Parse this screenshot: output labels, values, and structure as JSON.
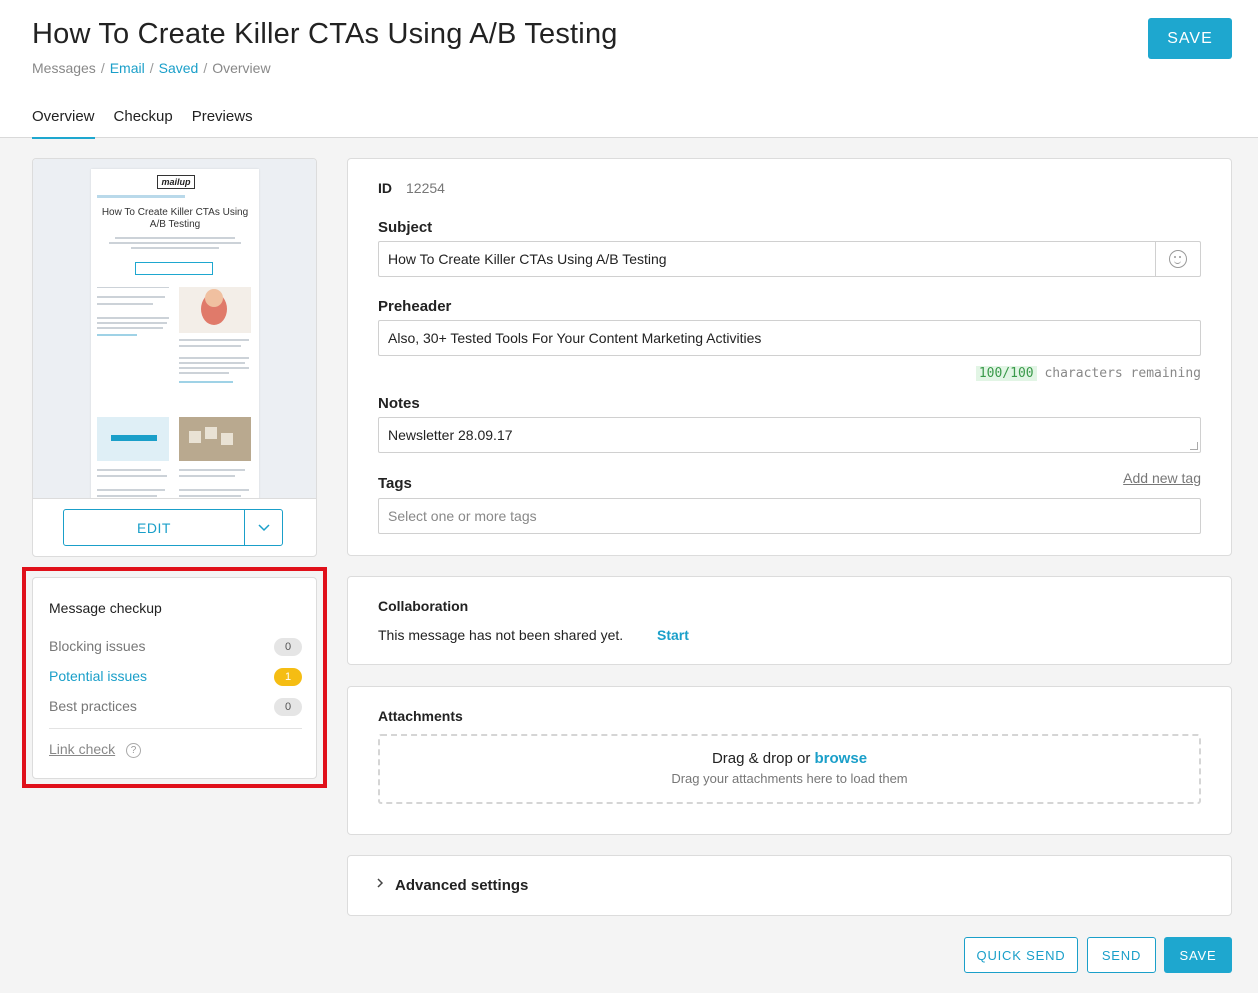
{
  "page": {
    "title": "How To Create Killer CTAs Using A/B Testing",
    "save_top": "SAVE"
  },
  "breadcrumb": {
    "messages": "Messages",
    "email": "Email",
    "saved": "Saved",
    "overview": "Overview",
    "separator": "/"
  },
  "tabs": [
    {
      "label": "Overview",
      "active": true
    },
    {
      "label": "Checkup",
      "active": false
    },
    {
      "label": "Previews",
      "active": false
    }
  ],
  "preview": {
    "heading": "How To Create Killer CTAs Using A/B Testing",
    "edit_label": "EDIT"
  },
  "checkup": {
    "title": "Message checkup",
    "items": [
      {
        "label": "Blocking issues",
        "count": "0"
      },
      {
        "label": "Potential issues",
        "count": "1"
      },
      {
        "label": "Best practices",
        "count": "0"
      }
    ],
    "link_check": "Link check",
    "help": "?"
  },
  "details": {
    "id_label": "ID",
    "id_value": "12254",
    "subject_label": "Subject",
    "subject_value": "How To Create Killer CTAs Using A/B Testing",
    "preheader_label": "Preheader",
    "preheader_value": "Also, 30+ Tested Tools For Your Content Marketing Activities",
    "chars_count": "100/100",
    "chars_text": "characters remaining",
    "notes_label": "Notes",
    "notes_value": "Newsletter 28.09.17",
    "tags_label": "Tags",
    "add_tag": "Add new tag",
    "tags_placeholder": "Select one or more tags"
  },
  "collaboration": {
    "title": "Collaboration",
    "text": "This message has not been shared yet.",
    "start": "Start"
  },
  "attachments": {
    "title": "Attachments",
    "drop_text": "Drag & drop or",
    "browse": "browse",
    "sub": "Drag your attachments here to load them"
  },
  "advanced": {
    "label": "Advanced settings"
  },
  "footer": {
    "quick_send": "QUICK SEND",
    "send": "SEND",
    "save": "SAVE"
  },
  "colors": {
    "accent": "#1ea7cf",
    "warning": "#f5bd13",
    "highlight": "#e0101a"
  }
}
